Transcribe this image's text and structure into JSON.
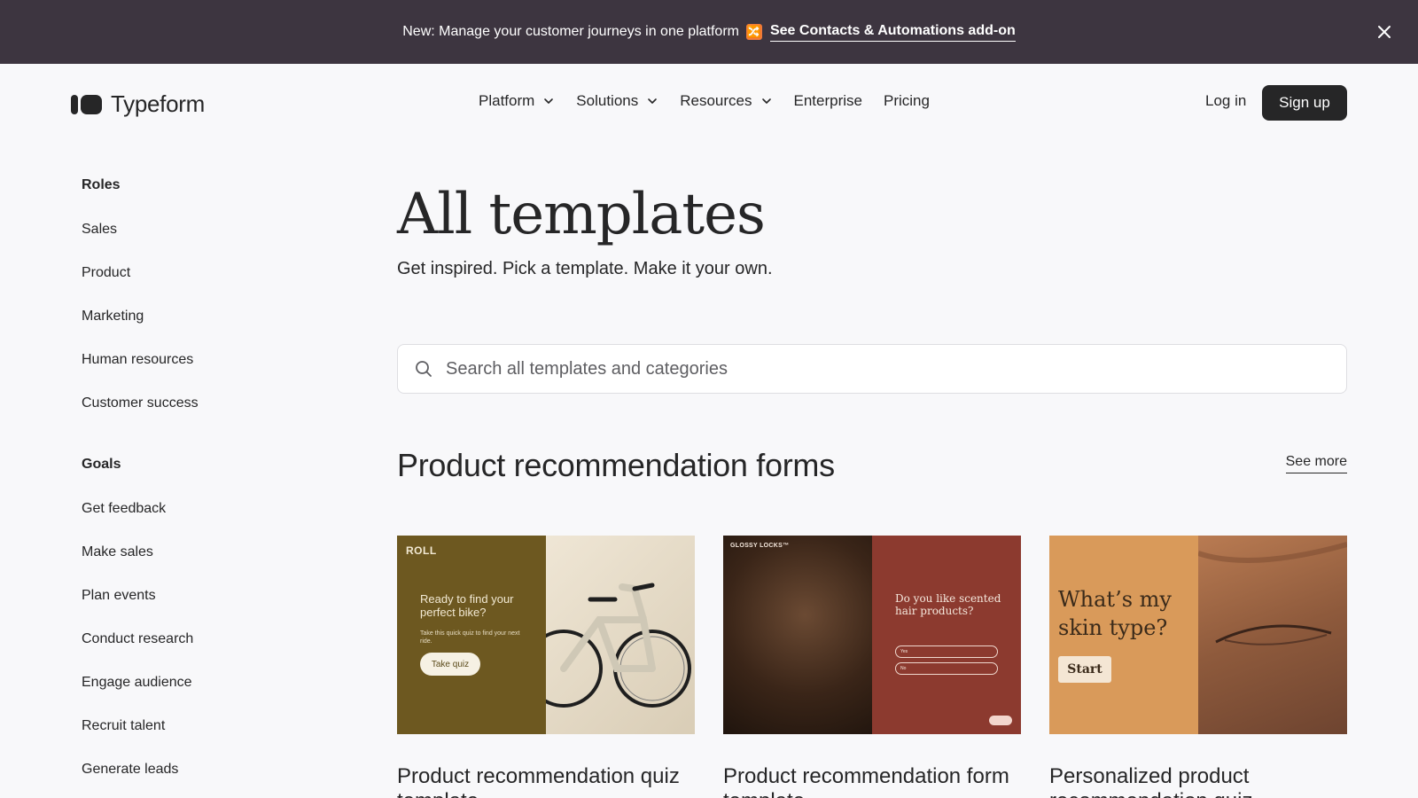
{
  "banner": {
    "message": "New: Manage your customer journeys in one platform",
    "emoji": "🔀",
    "link": "See Contacts & Automations add-on"
  },
  "nav": {
    "logo_text": "Typeform",
    "menu": [
      {
        "label": "Platform",
        "dropdown": true
      },
      {
        "label": "Solutions",
        "dropdown": true
      },
      {
        "label": "Resources",
        "dropdown": true
      },
      {
        "label": "Enterprise",
        "dropdown": false
      },
      {
        "label": "Pricing",
        "dropdown": false
      }
    ],
    "login": "Log in",
    "signup": "Sign up"
  },
  "sidebar": {
    "roles": {
      "heading": "Roles",
      "items": [
        "Sales",
        "Product",
        "Marketing",
        "Human resources",
        "Customer success"
      ]
    },
    "goals": {
      "heading": "Goals",
      "items": [
        "Get feedback",
        "Make sales",
        "Plan events",
        "Conduct research",
        "Engage audience",
        "Recruit talent",
        "Generate leads"
      ]
    }
  },
  "main": {
    "title": "All templates",
    "subtitle": "Get inspired. Pick a template. Make it your own.",
    "search_placeholder": "Search all templates and categories",
    "section_title": "Product recommendation forms",
    "see_more": "See more",
    "cards": [
      {
        "title": "Product recommendation quiz template",
        "thumb": {
          "brand": "ROLL",
          "question": "Ready to find your perfect bike?",
          "sub": "Take this quick quiz to find your next ride.",
          "button": "Take quiz"
        }
      },
      {
        "title": "Product recommendation form template",
        "thumb": {
          "brand": "GLOSSY LOCKS™",
          "question": "Do you like scented hair products?",
          "options": [
            "Yes",
            "No"
          ]
        }
      },
      {
        "title": "Personalized product recommendation quiz",
        "thumb": {
          "question": "What’s my skin type?",
          "button": "Start"
        }
      }
    ]
  },
  "colors": {
    "banner_bg": "#3d3540",
    "page_bg": "#f8f8fa",
    "text": "#262627",
    "signup_bg": "#262627"
  }
}
